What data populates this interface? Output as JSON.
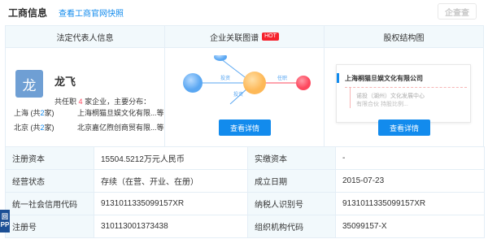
{
  "header": {
    "title": "工商信息",
    "snapshot_link": "查看工商官网快照",
    "watermark": "企查查"
  },
  "legal_rep": {
    "heading": "法定代表人信息",
    "avatar_char": "龙",
    "name": "龙飞",
    "summary_prefix": "共任职",
    "summary_count": "4",
    "summary_suffix": "家企业，主要分布：",
    "locations": [
      {
        "city": "上海",
        "count_prefix": "(共",
        "count": "2",
        "count_suffix": "家)",
        "company": "上海桐猫旦娱文化有限...等"
      },
      {
        "city": "北京",
        "count_prefix": "(共",
        "count": "2",
        "count_suffix": "家)",
        "company": "北京嘉亿煦创商贸有限...等"
      }
    ]
  },
  "relation_graph": {
    "heading": "企业关联图谱",
    "hot_badge": "HOT",
    "edge_labels": [
      "投资",
      "任职",
      "投资"
    ],
    "button": "查看详情",
    "colors": {
      "center": "#fdb857",
      "left": "#5aa7f2",
      "right": "#fd485e",
      "top": "#5aa7f2"
    }
  },
  "equity": {
    "heading": "股权结构图",
    "company": "上海桐猫旦娱文化有限公司",
    "sub_line_1": "诺投（湖州）文化发展中心",
    "sub_line_2": "有限合伙  持股比例...",
    "button": "查看详情"
  },
  "info_table": {
    "rows": [
      {
        "l1": "注册资本",
        "v1": "15504.5212万元人民币",
        "l2": "实缴资本",
        "v2": "-"
      },
      {
        "l1": "经营状态",
        "v1": "存续（在营、开业、在册）",
        "l2": "成立日期",
        "v2": "2015-07-23"
      },
      {
        "l1": "统一社会信用代码",
        "v1": "9131011335099157XR",
        "l2": "纳税人识别号",
        "v2": "9131011335099157XR"
      },
      {
        "l1": "注册号",
        "v1": "310113001373438",
        "l2": "组织机构代码",
        "v2": "35099157-X"
      }
    ]
  },
  "side_tab": {
    "line1": "回",
    "line2": "PP"
  }
}
